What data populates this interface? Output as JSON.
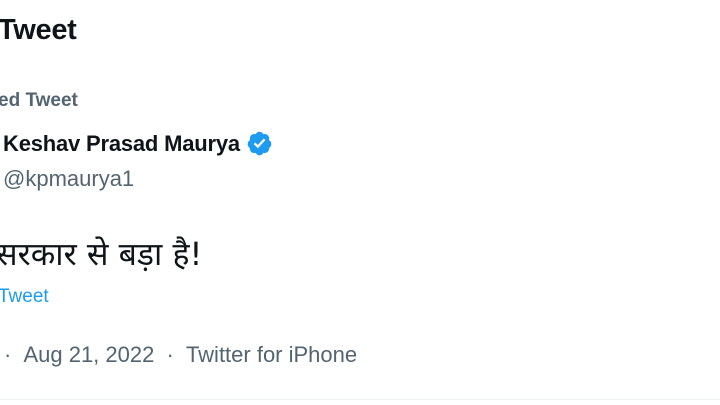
{
  "header": {
    "title": "Tweet"
  },
  "pinned": {
    "label": "ed Tweet"
  },
  "author": {
    "name": "Keshav Prasad Maurya",
    "handle": "@kpmaurya1",
    "verified_icon": "verified-badge-icon",
    "verified_color": "#1d9bf0"
  },
  "tweet": {
    "text": "सरकार से बड़ा है!",
    "translate_label": "Tweet"
  },
  "meta": {
    "separator_left": "·",
    "date": "Aug 21, 2022",
    "separator_right": "·",
    "source": "Twitter for iPhone"
  },
  "colors": {
    "text_primary": "#0f1419",
    "text_secondary": "#536471",
    "link": "#1d9bf0"
  }
}
